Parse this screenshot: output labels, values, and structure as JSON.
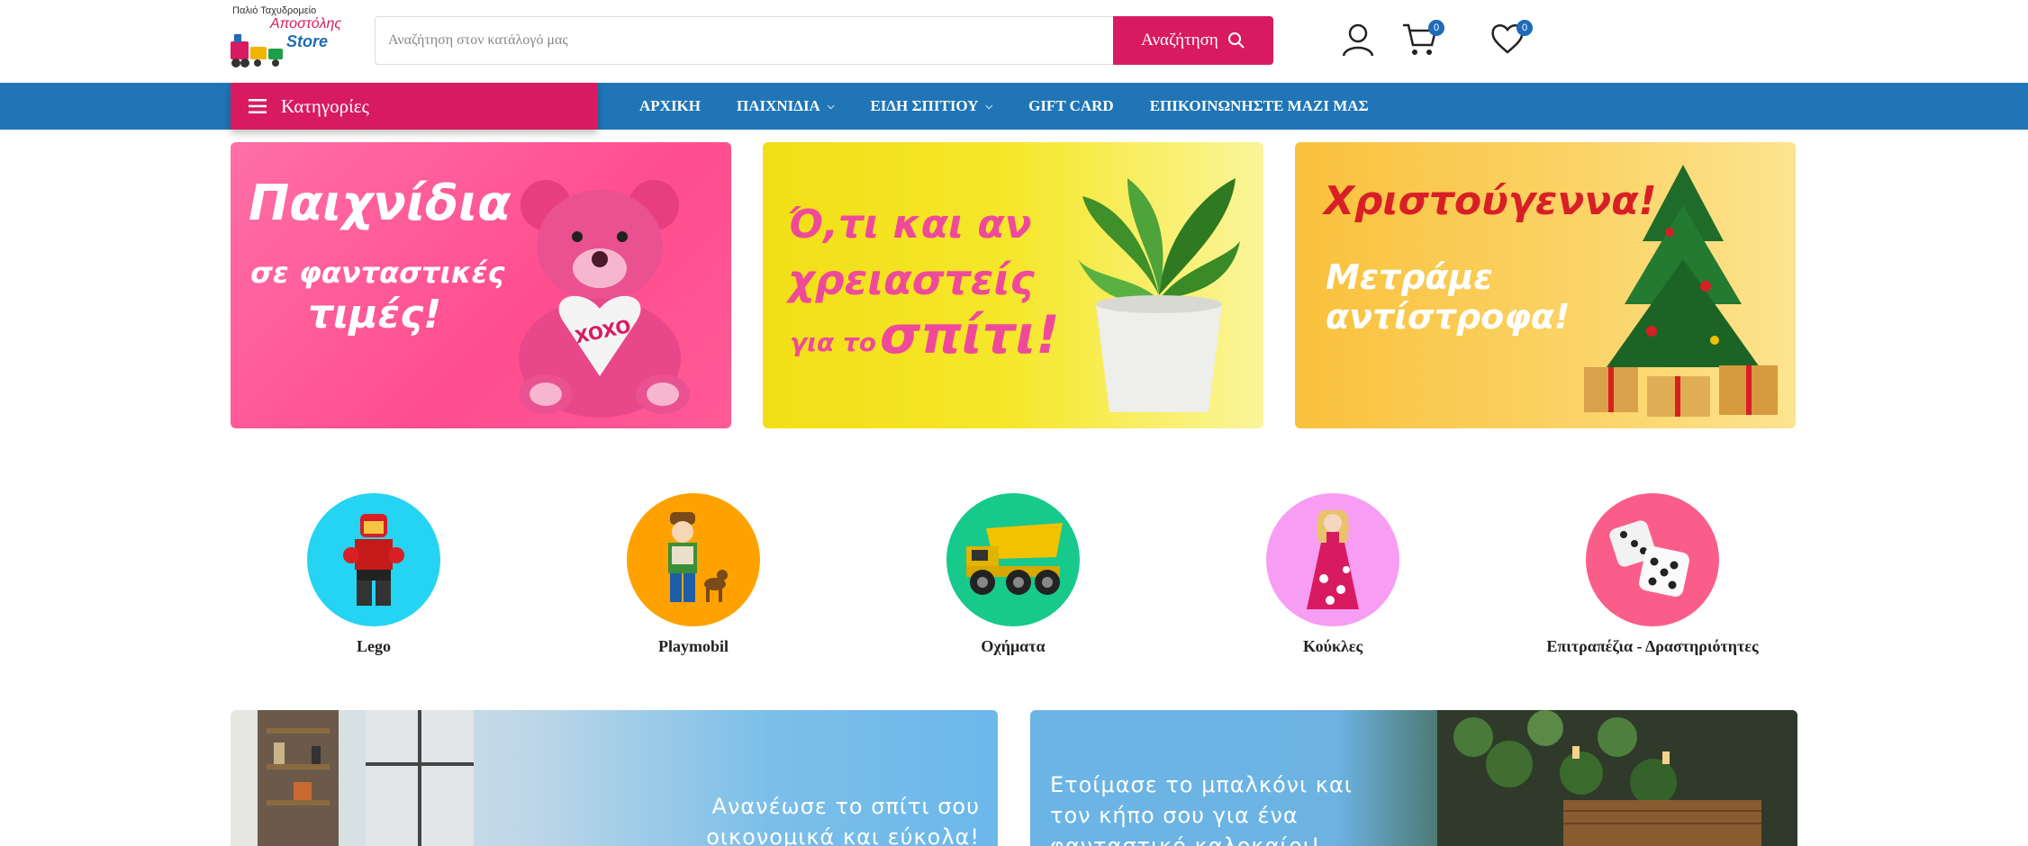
{
  "header": {
    "logo": {
      "top_text": "Παλιό Ταχυδρομείο",
      "name": "Αποστόλης",
      "store": "Store"
    },
    "search": {
      "placeholder": "Αναζήτηση στον κατάλογό μας",
      "button_label": "Αναζήτηση"
    },
    "account_icon": "user-icon",
    "cart": {
      "icon": "cart-icon",
      "count": "0"
    },
    "wishlist": {
      "icon": "heart-icon",
      "count": "0"
    }
  },
  "nav": {
    "categories_label": "Κατηγορίες",
    "links": [
      {
        "label": "ΑΡΧΙΚΗ",
        "dropdown": false
      },
      {
        "label": "ΠΑΙΧΝΙΔΙΑ",
        "dropdown": true
      },
      {
        "label": "ΕΙΔΗ ΣΠΙΤΙΟΥ",
        "dropdown": true
      },
      {
        "label": "GIFT CARD",
        "dropdown": false
      },
      {
        "label": "ΕΠΙΚΟΙΝΩΝΗΣΤΕ ΜΑΖΙ ΜΑΣ",
        "dropdown": false
      }
    ]
  },
  "banners": [
    {
      "line1": "Παιχνίδια",
      "line2": "σε φανταστικές",
      "line3": "τιμές!",
      "extra": "XOXO",
      "color": "#ff5a97"
    },
    {
      "line1": "Ό,τι και αν",
      "line2": "χρειαστείς",
      "line3a": "για το",
      "line3b": "σπίτι!",
      "color": "#f1df16"
    },
    {
      "line1": "Χριστούγεννα!",
      "line2": "Μετράμε",
      "line3": "αντίστροφα!",
      "color": "#f9c13b"
    }
  ],
  "categories": [
    {
      "label": "Lego",
      "color": "#25d3f2"
    },
    {
      "label": "Playmobil",
      "color": "#ffa200"
    },
    {
      "label": "Οχήματα",
      "color": "#17c98a"
    },
    {
      "label": "Κούκλες",
      "color": "#f79df4"
    },
    {
      "label": "Επιτραπέζια - Δραστηριότητες",
      "color": "#fb5d8a"
    }
  ],
  "bottom_banners": [
    {
      "line1": "Ανανέωσε το σπίτι σου",
      "line2": "οικονομικά και εύκολα!"
    },
    {
      "line1": "Ετοίμασε το μπαλκόνι και",
      "line2": "τον κήπο σου για ένα",
      "line3": "φανταστικό καλοκαίρι!"
    }
  ],
  "colors": {
    "brand_pink": "#d81b60",
    "nav_blue": "#1f75b6"
  }
}
